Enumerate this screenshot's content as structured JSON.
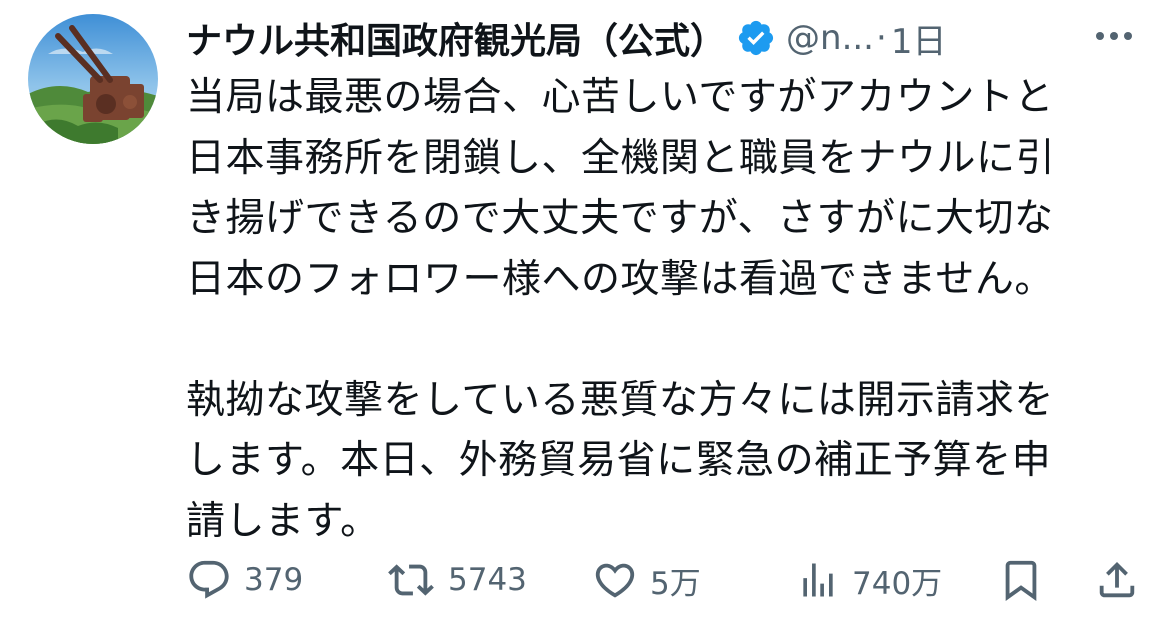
{
  "author": {
    "display_name": "ナウル共和国政府観光局（公式）",
    "handle": "@n...",
    "separator": "·",
    "time": "1日",
    "verified": true,
    "verified_color": "#1d9bf0"
  },
  "tweet": {
    "text": "当局は最悪の場合、心苦しいですがアカウントと\n日本事務所を閉鎖し、全機関と職員をナウルに引\nき揚げできるので大丈夫ですが、さすがに大切な\n日本のフォロワー様への攻撃は看過できません。\n\n執拗な攻撃をしている悪質な方々には開示請求を\nします。本日、外務貿易省に緊急の補正予算を申\n請します。"
  },
  "actions": {
    "reply": {
      "icon": "reply-icon",
      "count": "379"
    },
    "retweet": {
      "icon": "retweet-icon",
      "count": "5743"
    },
    "like": {
      "icon": "heart-icon",
      "count": "5万"
    },
    "views": {
      "icon": "views-icon",
      "count": "740万"
    },
    "bookmark": {
      "icon": "bookmark-icon"
    },
    "share": {
      "icon": "share-icon"
    }
  },
  "colors": {
    "text": "#0f1419",
    "secondary": "#536471",
    "background": "#ffffff"
  }
}
